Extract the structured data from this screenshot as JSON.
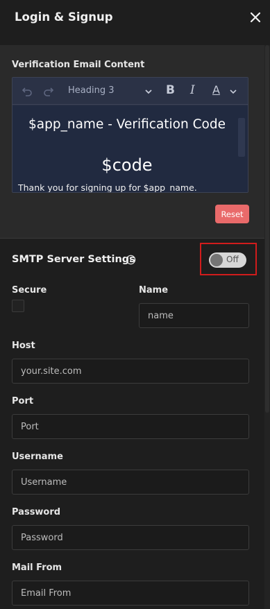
{
  "header": {
    "title": "Login & Signup",
    "close_icon": "close-icon"
  },
  "verification": {
    "label": "Verification Email Content",
    "toolbar": {
      "heading": "Heading 3",
      "bold": "B",
      "italic": "I",
      "color": "A"
    },
    "content": {
      "title": "$app_name - Verification Code",
      "code": "$code",
      "body": "Thank you for signing up for $app_name."
    },
    "reset_label": "Reset"
  },
  "smtp": {
    "title": "SMTP Server Settings",
    "toggle_label": "Off",
    "toggle_on": false,
    "highlight_color": "#d11c1c",
    "fields": {
      "secure_label": "Secure",
      "name_label": "Name",
      "name_placeholder": "name",
      "host_label": "Host",
      "host_placeholder": "your.site.com",
      "port_label": "Port",
      "port_placeholder": "Port",
      "username_label": "Username",
      "username_placeholder": "Username",
      "password_label": "Password",
      "password_placeholder": "Password",
      "mailfrom_label": "Mail From",
      "mailfrom_placeholder": "Email From"
    }
  },
  "colors": {
    "accent_reset": "#e96a6a",
    "editor_bg": "#212a40"
  }
}
